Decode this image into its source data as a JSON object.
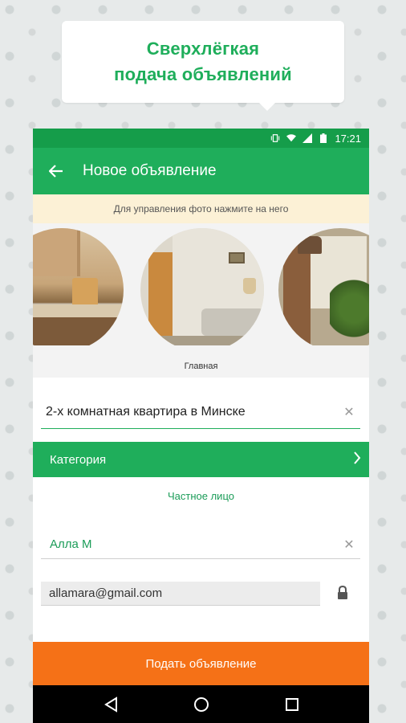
{
  "promo": {
    "line1": "Сверхлёгкая",
    "line2": "подача объявлений"
  },
  "status_bar": {
    "time": "17:21",
    "icons": [
      "vibrate-icon",
      "wifi-icon",
      "signal-icon",
      "battery-icon"
    ]
  },
  "toolbar": {
    "title": "Новое объявление",
    "back_icon": "arrow-left-icon"
  },
  "hint": "Для управления фото нажмите на него",
  "photos": {
    "main_label": "Главная",
    "items": [
      "kitchen-photo",
      "living-room-photo",
      "bedroom-photo"
    ]
  },
  "form": {
    "title_value": "2-х комнатная квартира в Минске",
    "category_label": "Категория",
    "private_link": "Частное лицо",
    "name_value": "Алла М",
    "email_value": "allamara@gmail.com"
  },
  "submit_label": "Подать объявление",
  "colors": {
    "brand_green": "#1fae5b",
    "status_green": "#159d4a",
    "submit_orange": "#f57117",
    "hint_bg": "#fcf1d6"
  }
}
